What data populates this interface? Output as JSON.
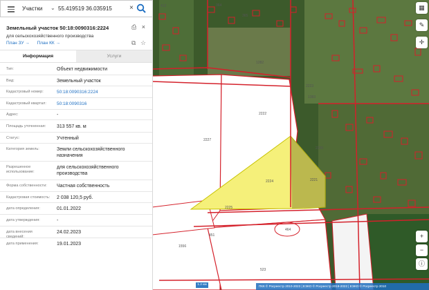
{
  "search": {
    "category": "Участки",
    "query": "55.419519 36.035915"
  },
  "card": {
    "title": "Земельный участок 50:18:0090316:2224",
    "subtitle": "для сельскохозяйственного производства",
    "links": [
      "План ЗУ",
      "План КК"
    ]
  },
  "tabs": [
    {
      "label": "Информация",
      "active": true
    },
    {
      "label": "Услуги",
      "active": false
    }
  ],
  "info_rows": [
    {
      "label": "Тип:",
      "value": "Объект недвижимости"
    },
    {
      "label": "Вид:",
      "value": "Земельный участок"
    },
    {
      "label": "Кадастровый номер:",
      "value": "50:18:0090316:2224"
    },
    {
      "label": "Кадастровый квартал:",
      "value": "50:18:0090316"
    },
    {
      "label": "Адрес:",
      "value": "-"
    },
    {
      "label": "Площадь уточненная:",
      "value": "313 557 кв. м"
    },
    {
      "label": "Статус:",
      "value": "Учтенный"
    },
    {
      "label": "Категория земель:",
      "value": "Земли сельскохозяйственного назначения"
    },
    {
      "label": "Разрешенное использование:",
      "value": "для сельскохозяйственного производства"
    },
    {
      "label": "Форма собственности:",
      "value": "Частная собственность"
    },
    {
      "label": "Кадастровая стоимость:",
      "value": "2 038 120,5 руб."
    },
    {
      "label": "дата определения:",
      "value": "01.01.2022"
    },
    {
      "label": "дата утверждения:",
      "value": "-"
    },
    {
      "label": "дата внесения сведений:",
      "value": "24.02.2023"
    },
    {
      "label": "дата применения:",
      "value": "19.01.2023"
    }
  ],
  "map": {
    "parcel_labels": [
      "412",
      "364",
      "365",
      "1282",
      "1383",
      "2227",
      "2222",
      "2224",
      "2221",
      "2225",
      "464",
      "451",
      "1556",
      "523",
      "2220",
      "2223"
    ],
    "scale_label": "1.2 км",
    "attribution": "ПКК © Росреестр 2010-2023 | ЕЭКО © Росреестр 2019-2022 | ЕЭКО © Росреестр 2010",
    "highlight_color": "#f5f07a",
    "border_color": "#d4202a"
  }
}
